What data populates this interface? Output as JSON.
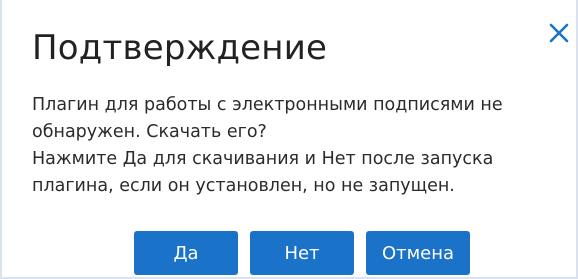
{
  "dialog": {
    "title": "Подтверждение",
    "close_icon": "close-icon",
    "message_line1": "Плагин для работы с электронными подписями не обнаружен. Скачать его?",
    "message_line2": "Нажмите Да для скачивания и Нет после запуска плагина, если он установлен, но не запущен.",
    "buttons": {
      "yes": "Да",
      "no": "Нет",
      "cancel": "Отмена"
    }
  },
  "colors": {
    "accent": "#1a73c8",
    "border": "#d9e2ee",
    "text": "#2b2b2b"
  }
}
